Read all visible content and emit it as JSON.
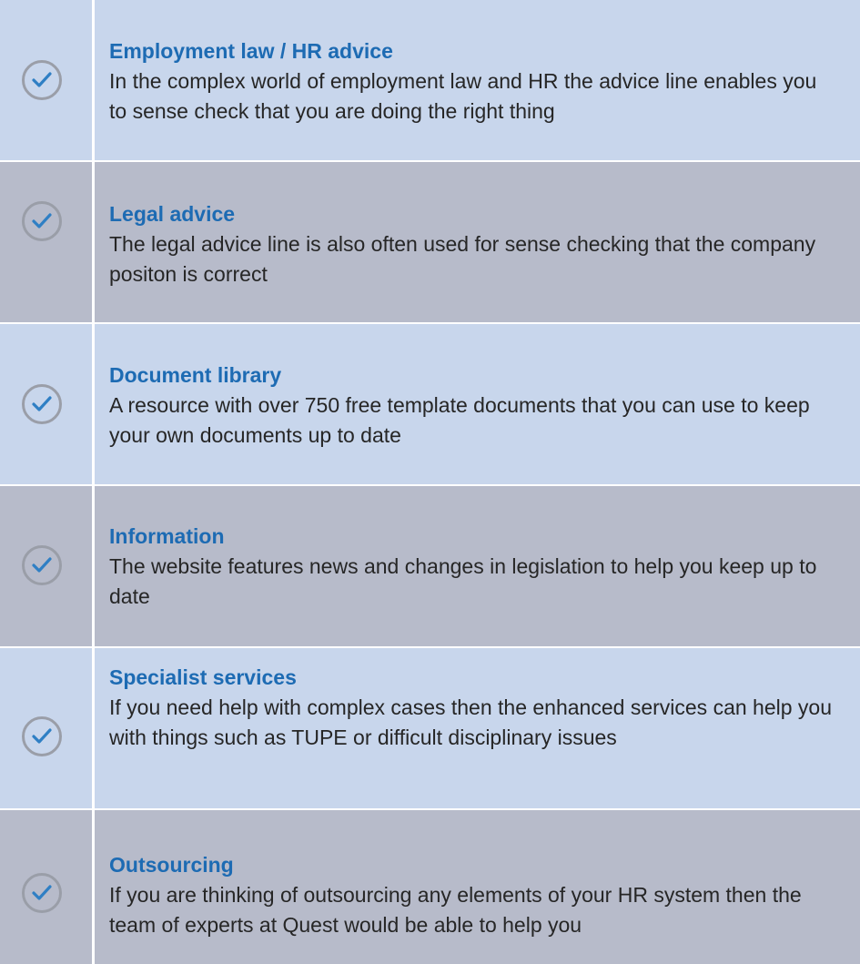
{
  "items": [
    {
      "title": "Employment law / HR advice",
      "description": "In the complex world of employment law and HR the advice line enables you to sense check that you are doing the right thing"
    },
    {
      "title": "Legal advice",
      "description": "The legal advice line is also often used for sense checking that the company positon is correct"
    },
    {
      "title": "Document library",
      "description": "A resource with over 750 free template documents that you can use to keep your own documents up to date"
    },
    {
      "title": "Information",
      "description": "The website features news and changes in legislation to help you keep up to date"
    },
    {
      "title": "Specialist services",
      "description": "If you need help with complex cases then the enhanced services can help you with things such as TUPE or difficult disciplinary issues"
    },
    {
      "title": "Outsourcing",
      "description": "If you are thinking of outsourcing any elements of your HR system then the team of experts at Quest would be able to help you"
    }
  ],
  "colors": {
    "title": "#1d6bb3",
    "row_light": "#c8d6ec",
    "row_dark": "#b7bbca",
    "check_icon": "#2f7fc4"
  },
  "icon": "check-circle-icon"
}
